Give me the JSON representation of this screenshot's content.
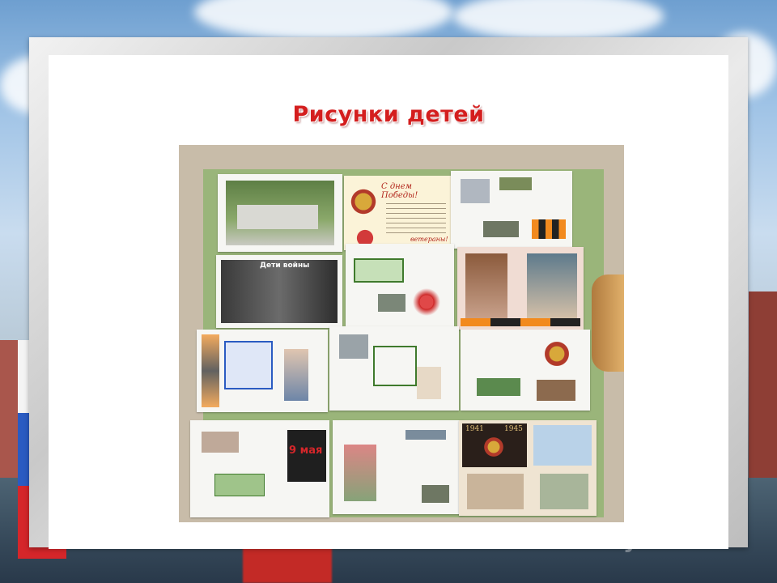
{
  "slide": {
    "title": "Рисунки детей",
    "watermark": "MyShared"
  },
  "collage": {
    "caption_war_children": "Дети войны",
    "card_header": "С днем Победы!",
    "card_footer": "ветераны!",
    "year_start": "1941",
    "year_end": "1945",
    "badge_nine": "9 мая"
  },
  "colors": {
    "title_red": "#d41e1e",
    "flag_white": "#f4f4f4",
    "flag_blue": "#2a5bc2",
    "flag_red": "#d5262a"
  }
}
